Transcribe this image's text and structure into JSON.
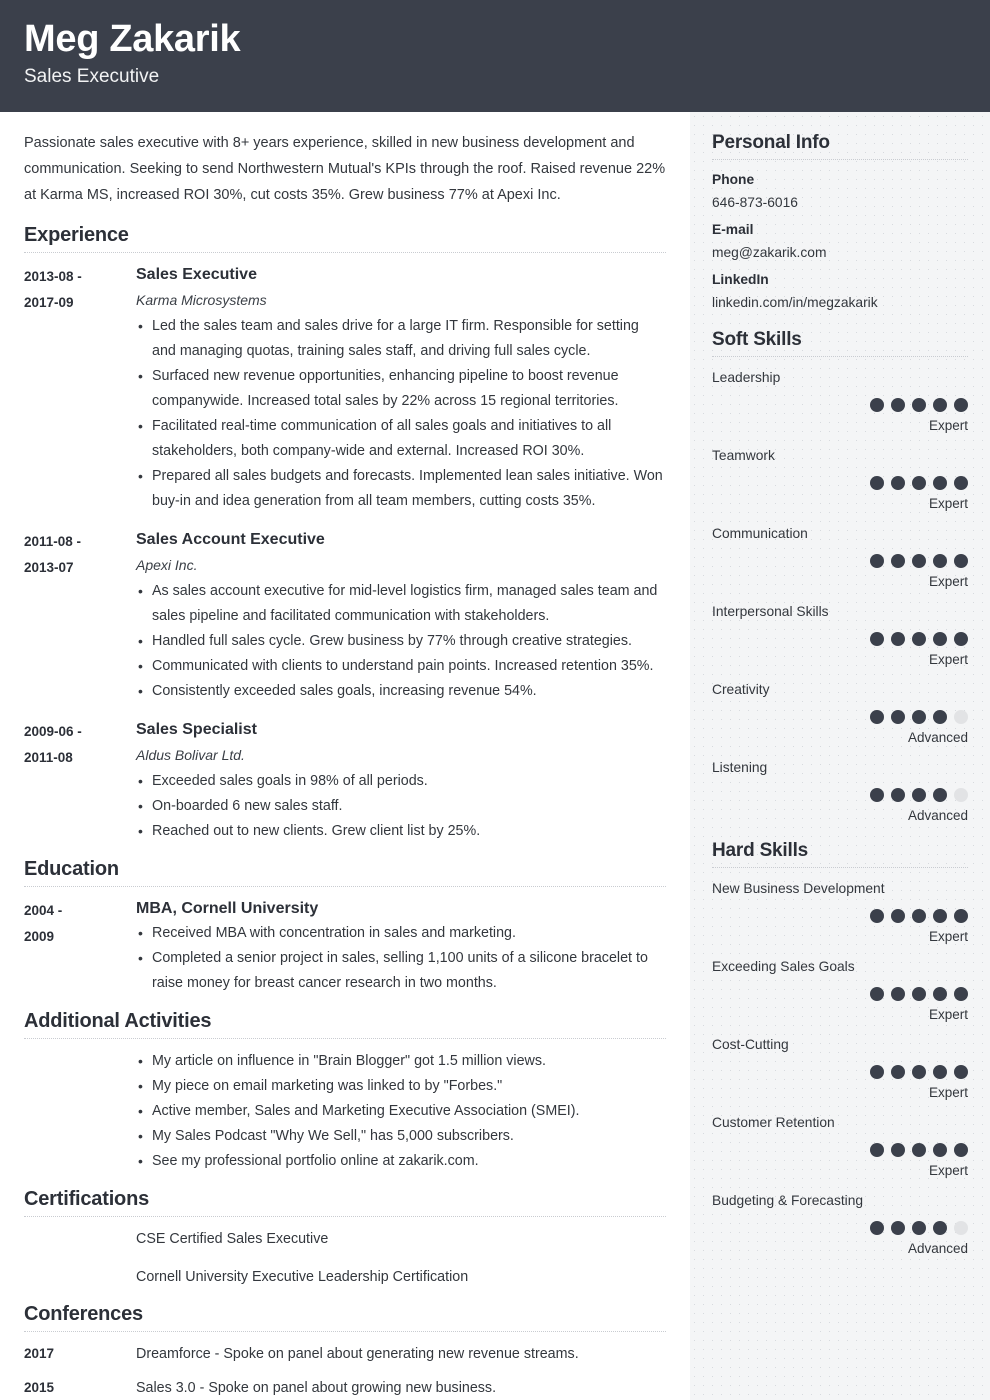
{
  "header": {
    "name": "Meg Zakarik",
    "job_title": "Sales Executive",
    "bg_color": "#3b404b"
  },
  "summary": "Passionate sales executive with 8+ years experience, skilled in new business development and communication. Seeking to send Northwestern Mutual's KPIs through the roof. Raised revenue 22% at Karma MS, increased ROI 30%, cut costs 35%. Grew business 77% at Apexi Inc.",
  "sections": {
    "experience_title": "Experience",
    "education_title": "Education",
    "activities_title": "Additional Activities",
    "certifications_title": "Certifications",
    "conferences_title": "Conferences"
  },
  "experience": [
    {
      "date_from": "2013-08 -",
      "date_to": "2017-09",
      "role": "Sales Executive",
      "org": "Karma Microsystems",
      "bullets": [
        "Led the sales team and sales drive for a large IT firm. Responsible for setting and managing quotas, training sales staff, and driving full sales cycle.",
        "Surfaced new revenue opportunities, enhancing pipeline to boost revenue companywide. Increased total sales by 22% across 15 regional territories.",
        "Facilitated real-time communication of all sales goals and initiatives to all stakeholders, both company-wide and external. Increased ROI 30%.",
        "Prepared all sales budgets and forecasts. Implemented lean sales initiative. Won buy-in and idea generation from all team members, cutting costs 35%."
      ]
    },
    {
      "date_from": "2011-08 -",
      "date_to": "2013-07",
      "role": "Sales Account Executive",
      "org": "Apexi Inc.",
      "bullets": [
        "As sales account executive for mid-level logistics firm, managed sales team and sales pipeline and facilitated communication with stakeholders.",
        "Handled full sales cycle. Grew business by 77% through creative strategies.",
        "Communicated with clients to understand pain points. Increased retention 35%.",
        "Consistently exceeded sales goals, increasing revenue 54%."
      ]
    },
    {
      "date_from": "2009-06 -",
      "date_to": "2011-08",
      "role": "Sales Specialist",
      "org": "Aldus Bolivar Ltd.",
      "bullets": [
        "Exceeded sales goals in 98% of all periods.",
        "On-boarded 6 new sales staff.",
        "Reached out to new clients. Grew client list by 25%."
      ]
    }
  ],
  "education": [
    {
      "date_from": "2004 -",
      "date_to": "2009",
      "degree": "MBA, Cornell University",
      "bullets": [
        "Received MBA with concentration in sales and marketing.",
        "Completed a senior project in sales, selling 1,100 units of a silicone bracelet to raise money for breast cancer research in two months."
      ]
    }
  ],
  "activities": [
    "My article on influence in \"Brain Blogger\" got 1.5 million views.",
    "My piece on email marketing was linked to by \"Forbes.\"",
    "Active member, Sales and Marketing Executive Association (SMEI).",
    "My Sales Podcast \"Why We Sell,\" has 5,000 subscribers.",
    "See my professional portfolio online at zakarik.com."
  ],
  "certifications": [
    "CSE Certified Sales Executive",
    "Cornell University Executive Leadership Certification"
  ],
  "conferences": [
    {
      "year": "2017",
      "text": "Dreamforce - Spoke on panel about generating new revenue streams."
    },
    {
      "year": "2015",
      "text": "Sales 3.0 - Spoke on panel about growing new business."
    }
  ],
  "sidebar": {
    "personal_info_title": "Personal Info",
    "personal_info": [
      {
        "label": "Phone",
        "value": "646-873-6016"
      },
      {
        "label": "E-mail",
        "value": "meg@zakarik.com"
      },
      {
        "label": "LinkedIn",
        "value": "linkedin.com/in/megzakarik"
      }
    ],
    "soft_skills_title": "Soft Skills",
    "soft_skills": [
      {
        "name": "Leadership",
        "filled": 5,
        "total": 5,
        "level": "Expert"
      },
      {
        "name": "Teamwork",
        "filled": 5,
        "total": 5,
        "level": "Expert"
      },
      {
        "name": "Communication",
        "filled": 5,
        "total": 5,
        "level": "Expert"
      },
      {
        "name": "Interpersonal Skills",
        "filled": 5,
        "total": 5,
        "level": "Expert"
      },
      {
        "name": "Creativity",
        "filled": 4,
        "total": 5,
        "level": "Advanced"
      },
      {
        "name": "Listening",
        "filled": 4,
        "total": 5,
        "level": "Advanced"
      }
    ],
    "hard_skills_title": "Hard Skills",
    "hard_skills": [
      {
        "name": "New Business Development",
        "filled": 5,
        "total": 5,
        "level": "Expert"
      },
      {
        "name": "Exceeding Sales Goals",
        "filled": 5,
        "total": 5,
        "level": "Expert"
      },
      {
        "name": "Cost-Cutting",
        "filled": 5,
        "total": 5,
        "level": "Expert"
      },
      {
        "name": "Customer Retention",
        "filled": 5,
        "total": 5,
        "level": "Expert"
      },
      {
        "name": "Budgeting & Forecasting",
        "filled": 4,
        "total": 5,
        "level": "Advanced"
      }
    ],
    "dot_filled_color": "#3b404b",
    "dot_empty_color": "#e2e3e5",
    "bg_color": "#f4f5f6"
  }
}
